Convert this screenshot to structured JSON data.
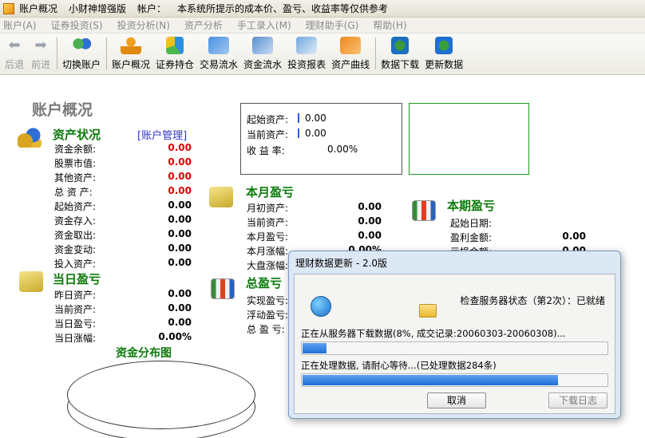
{
  "titlebar": {
    "app_name": "账户概况",
    "edition": "小财神增强版",
    "account_label": "帐户：",
    "notice": "本系统所提示的成本价、盈亏、收益率等仅供参考"
  },
  "menu": [
    "账户(A)",
    "证券投资(S)",
    "投资分析(N)",
    "资产分析",
    "手工录入(M)",
    "理财助手(G)",
    "帮助(H)"
  ],
  "toolbar": {
    "back": "后退",
    "forward": "前进",
    "switch_account": "切换账户",
    "account_overview": "账户概况",
    "holdings": "证券持仓",
    "trade_flow": "交易流水",
    "fund_flow": "资金流水",
    "invest_report": "投资报表",
    "asset_curve": "资产曲线",
    "data_download": "数据下载",
    "update_data": "更新数据"
  },
  "page_title": "账户概况",
  "asset_status": {
    "title": "资产状况",
    "manage_link": "[账户管理]",
    "rows": [
      {
        "label": "资金余额:",
        "value": "0.00"
      },
      {
        "label": "股票市值:",
        "value": "0.00"
      },
      {
        "label": "其他资产:",
        "value": "0.00"
      },
      {
        "label": "总 资 产:",
        "value": "0.00"
      },
      {
        "label": "起始资产:",
        "value": "0.00"
      },
      {
        "label": "资金存入:",
        "value": "0.00"
      },
      {
        "label": "资金取出:",
        "value": "0.00"
      },
      {
        "label": "资金变动:",
        "value": "0.00"
      },
      {
        "label": "投入资产:",
        "value": "0.00"
      }
    ]
  },
  "daily_pl": {
    "title": "当日盈亏",
    "rows": [
      {
        "label": "昨日资产:",
        "value": "0.00"
      },
      {
        "label": "当前资产:",
        "value": "0.00"
      },
      {
        "label": "当日盈亏:",
        "value": "0.00"
      },
      {
        "label": "当日涨幅:",
        "value": "0.00%"
      }
    ]
  },
  "summary": {
    "rows": [
      {
        "label": "起始资产:",
        "value": "0.00"
      },
      {
        "label": "当前资产:",
        "value": "0.00"
      },
      {
        "label": "收 益 率:",
        "value": "0.00%"
      }
    ]
  },
  "monthly_pl": {
    "title": "本月盈亏",
    "rows": [
      {
        "label": "月初资产:",
        "value": "0.00"
      },
      {
        "label": "当前资产:",
        "value": "0.00"
      },
      {
        "label": "本月盈亏:",
        "value": "0.00"
      },
      {
        "label": "本月涨幅:",
        "value": "0.00%"
      },
      {
        "label": "大盘涨幅:",
        "value": ""
      }
    ]
  },
  "period_pl": {
    "title": "本期盈亏",
    "rows": [
      {
        "label": "起始日期:",
        "value": ""
      },
      {
        "label": "盈利金额:",
        "value": "0.00"
      },
      {
        "label": "亏损金额:",
        "value": "0.00"
      }
    ]
  },
  "total_pl": {
    "title": "总盈亏",
    "rows": [
      {
        "label": "实现盈亏:"
      },
      {
        "label": "浮动盈亏:"
      },
      {
        "label": "总 盈 亏:"
      }
    ]
  },
  "fund_distribution": {
    "title": "资金分布图"
  },
  "dialog": {
    "title": "理财数据更新 - 2.0版",
    "server_status": "检查服务器状态（第2次）：已就绪",
    "download_text": "正在从服务器下载数据(8%, 成交记录:20060303-20060308)...",
    "download_progress": 0.08,
    "process_text": "正在处理数据, 请耐心等待...(已处理数据284条)",
    "process_progress": 0.84,
    "cancel": "取消",
    "log": "下载日志"
  }
}
